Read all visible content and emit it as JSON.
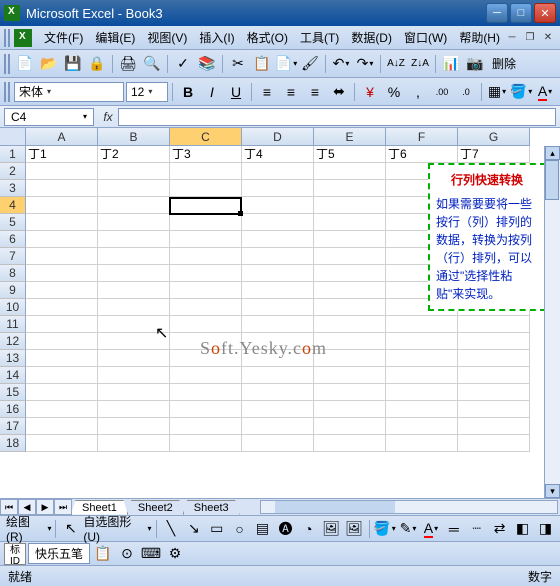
{
  "window": {
    "title": "Microsoft Excel - Book3"
  },
  "menu": {
    "items": [
      "文件(F)",
      "编辑(E)",
      "视图(V)",
      "插入(I)",
      "格式(O)",
      "工具(T)",
      "数据(D)",
      "窗口(W)",
      "帮助(H)"
    ]
  },
  "format": {
    "font": "宋体",
    "size": "12"
  },
  "formula": {
    "cellref": "C4",
    "fx": "fx",
    "value": ""
  },
  "columns": [
    "A",
    "B",
    "C",
    "D",
    "E",
    "F",
    "G"
  ],
  "rows": [
    "1",
    "2",
    "3",
    "4",
    "5",
    "6",
    "7",
    "8",
    "9",
    "10",
    "11",
    "12",
    "13",
    "14",
    "15",
    "16",
    "17",
    "18"
  ],
  "active": {
    "col": 2,
    "row": 3,
    "colLetter": "C",
    "rowNum": "4"
  },
  "cells": {
    "row1": [
      "丁1",
      "丁2",
      "丁3",
      "丁4",
      "丁5",
      "丁6",
      "丁7"
    ]
  },
  "tip": {
    "title": "行列快速转换",
    "body": "如果需要要将一些按行（列）排列的数据，转换为按列（行）排列，可以通过\"选择性粘贴\"来实现。"
  },
  "watermark": "Soft.Yesky.com",
  "sheets": [
    "Sheet1",
    "Sheet2",
    "Sheet3"
  ],
  "draw": {
    "label": "绘图(R)",
    "autoshape": "自选图形(U)"
  },
  "ime": {
    "name": "快乐五笔"
  },
  "status": {
    "left": "就绪",
    "right": "数字"
  },
  "toolbar_labels": {
    "delete": "删除"
  }
}
